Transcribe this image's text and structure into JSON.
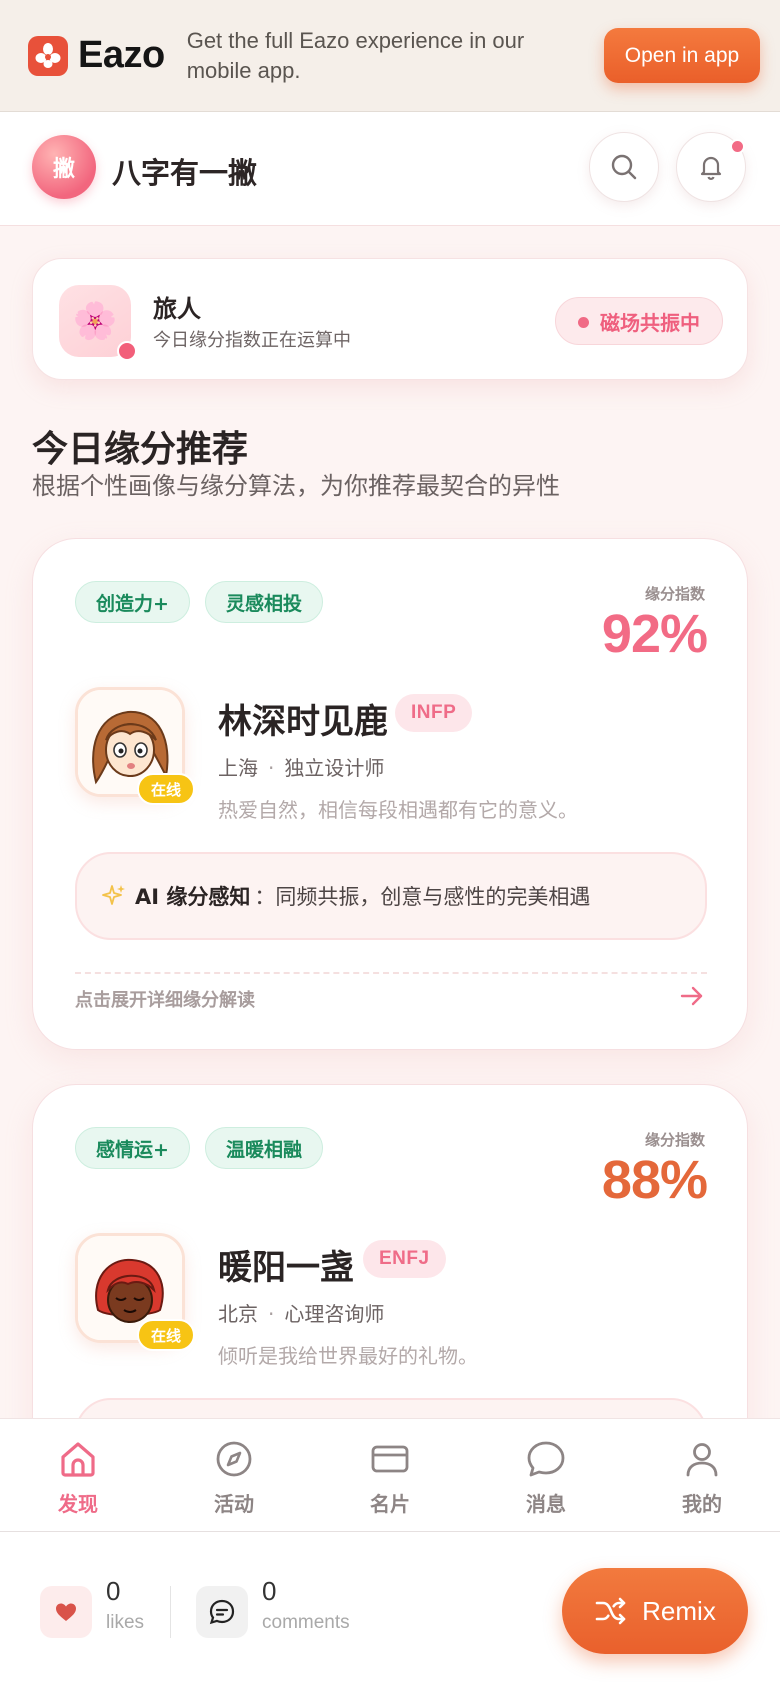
{
  "banner": {
    "logo_text": "Eazo",
    "message": "Get the full Eazo experience in our mobile app.",
    "open_app_label": "Open in app"
  },
  "header": {
    "avatar_char": "撇",
    "title": "八字有一撇"
  },
  "me": {
    "name": "旅人",
    "status": "今日缘分指数正在运算中",
    "badge": "磁场共振中"
  },
  "section": {
    "title": "今日缘分推荐",
    "subtitle": "根据个性画像与缘分算法，为你推荐最契合的异性"
  },
  "matches": [
    {
      "tags": [
        "创造力+",
        "灵感相投"
      ],
      "score_label": "缘分指数",
      "score": "92%",
      "score_color": "#f26b85",
      "name": "林深时见鹿",
      "mbti": "INFP",
      "city": "上海",
      "job": "独立设计师",
      "bio": "热爱自然，相信每段相遇都有它的意义。",
      "online_label": "在线",
      "ai_label": "AI 缘分感知",
      "ai_text": "：同频共振，创意与感性的完美相遇",
      "expand_label": "点击展开详细缘分解读"
    },
    {
      "tags": [
        "感情运+",
        "温暖相融"
      ],
      "score_label": "缘分指数",
      "score": "88%",
      "score_color": "#e4683a",
      "name": "暖阳一盏",
      "mbti": "ENFJ",
      "city": "北京",
      "job": "心理咨询师",
      "bio": "倾听是我给世界最好的礼物。",
      "online_label": "在线"
    }
  ],
  "tabs": [
    {
      "label": "发现",
      "icon": "home-icon",
      "active": true
    },
    {
      "label": "活动",
      "icon": "compass-icon",
      "active": false
    },
    {
      "label": "名片",
      "icon": "card-icon",
      "active": false
    },
    {
      "label": "消息",
      "icon": "chat-icon",
      "active": false
    },
    {
      "label": "我的",
      "icon": "user-icon",
      "active": false
    }
  ],
  "footer": {
    "likes_count": "0",
    "likes_label": "likes",
    "comments_count": "0",
    "comments_label": "comments",
    "remix_label": "Remix"
  },
  "colors": {
    "accent_pink": "#f26b85",
    "accent_orange": "#ea5f2a",
    "tag_green": "#1a8a5c",
    "online_yellow": "#f7c414"
  }
}
